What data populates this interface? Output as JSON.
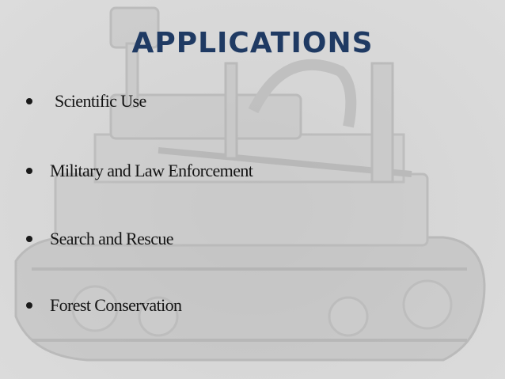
{
  "slide": {
    "title": "APPLICATIONS",
    "bullets": [
      {
        "label": "Scientific Use"
      },
      {
        "label": "Military and Law Enforcement"
      },
      {
        "label": "Search and Rescue"
      },
      {
        "label": "Forest Conservation"
      }
    ]
  },
  "colors": {
    "title": "#1f3a63",
    "text": "#141414",
    "background": "#d7d7d7"
  },
  "background_image": {
    "subject": "faded robot-tank-photo"
  }
}
